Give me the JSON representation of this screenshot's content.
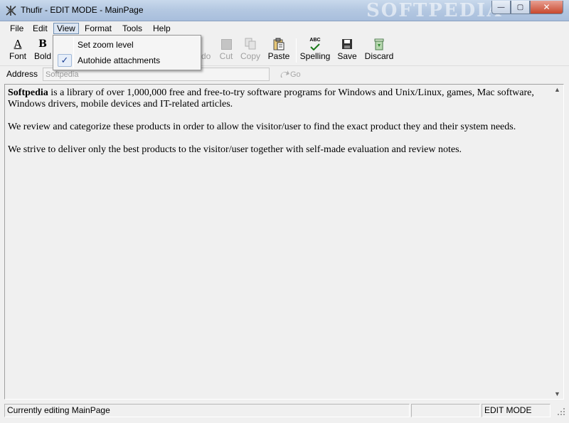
{
  "window": {
    "title": "Thufir - EDIT MODE -  MainPage",
    "watermark": "SOFTPEDIA",
    "controls": {
      "minimize": "—",
      "maximize": "▢",
      "close": "✕"
    }
  },
  "menubar": {
    "items": [
      "File",
      "Edit",
      "View",
      "Format",
      "Tools",
      "Help"
    ],
    "active": "View"
  },
  "view_menu": {
    "items": [
      {
        "label": "Set zoom level",
        "checked": false
      },
      {
        "label": "Autohide attachments",
        "checked": true
      }
    ],
    "check_glyph": "✓"
  },
  "toolbar": {
    "font": "Font",
    "bold": "Bold",
    "redo": "Redo",
    "cut": "Cut",
    "copy": "Copy",
    "paste": "Paste",
    "spelling": "Spelling",
    "save": "Save",
    "discard": "Discard",
    "font_glyph": "A",
    "bold_glyph": "B",
    "spell_glyph": "ABC"
  },
  "address": {
    "label": "Address",
    "value": "Softpedia",
    "go": "Go"
  },
  "document": {
    "p1_bold": "Softpedia",
    "p1_rest": " is a library of over 1,000,000 free and free-to-try software programs for Windows and Unix/Linux, games, Mac software, Windows drivers, mobile devices and IT-related articles.",
    "p2": "We review and categorize these products in order to allow the visitor/user to find the exact product they and their system needs.",
    "p3": "We strive to deliver only the best products to the visitor/user together with self-made evaluation and review notes."
  },
  "statusbar": {
    "message": "Currently editing MainPage",
    "panel2": "",
    "mode": "EDIT MODE"
  },
  "colors": {
    "titlebar": "#b5c9e2",
    "menu_highlight": "#dce6f3",
    "check": "#1c3f94"
  }
}
